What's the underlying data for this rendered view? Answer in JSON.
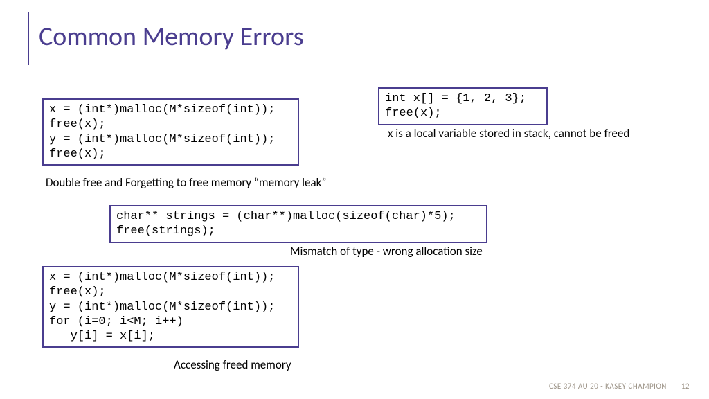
{
  "title": "Common Memory Errors",
  "box1": {
    "code": "x = (int*)malloc(M*sizeof(int));\nfree(x);\ny = (int*)malloc(M*sizeof(int));\nfree(x);",
    "caption": "Double free and Forgetting to free memory “memory leak”"
  },
  "box2": {
    "code": "int x[] = {1, 2, 3};\nfree(x);",
    "caption": "x is a local variable stored in stack, cannot be freed"
  },
  "box3": {
    "code": "char** strings = (char**)malloc(sizeof(char)*5);\nfree(strings);",
    "caption": "Mismatch of type - wrong allocation size"
  },
  "box4": {
    "code": "x = (int*)malloc(M*sizeof(int));\nfree(x);\ny = (int*)malloc(M*sizeof(int));\nfor (i=0; i<M; i++)\n   y[i] = x[i];",
    "caption": "Accessing freed memory"
  },
  "footer": {
    "text": "CSE 374 AU 20 - KASEY CHAMPION",
    "page": "12"
  }
}
